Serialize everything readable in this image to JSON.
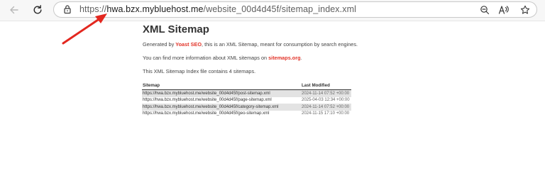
{
  "browser": {
    "url": {
      "scheme": "https://",
      "host": "hwa.bzx.mybluehost.me",
      "path": "/website_00d4d45f/sitemap_index.xml"
    },
    "icons": {
      "back": "arrow-left-icon",
      "refresh": "refresh-icon",
      "lock": "lock-icon",
      "zoom": "zoom-out-icon",
      "read_aloud": "read-aloud-icon",
      "favorite": "star-icon"
    }
  },
  "page": {
    "title": "XML Sitemap",
    "para1": {
      "prefix": "Generated by ",
      "link": "Yoast SEO",
      "suffix": ", this is an XML Sitemap, meant for consumption by search engines."
    },
    "para2": {
      "prefix": "You can find more information about XML sitemaps on ",
      "link": "sitemaps.org",
      "suffix": "."
    },
    "para3": "This XML Sitemap Index file contains 4 sitemaps.",
    "table": {
      "headers": [
        "Sitemap",
        "Last Modified"
      ],
      "rows": [
        {
          "url": "https://hwa.bzx.mybluehost.me/website_00d4d45f/post-sitemap.xml",
          "modified": "2024-11-14 07:52 +00:00"
        },
        {
          "url": "https://hwa.bzx.mybluehost.me/website_00d4d45f/page-sitemap.xml",
          "modified": "2025-04-03 12:34 +00:00"
        },
        {
          "url": "https://hwa.bzx.mybluehost.me/website_00d4d45f/category-sitemap.xml",
          "modified": "2024-11-14 07:52 +00:00"
        },
        {
          "url": "https://hwa.bzx.mybluehost.me/website_00d4d45f/geo-sitemap.xml",
          "modified": "2024-11-15 17:10 +00:00"
        }
      ]
    }
  },
  "annotation": {
    "color": "#e3271f"
  },
  "colors": {
    "link": "#e2352a",
    "toolbar": "#f7f7f7"
  }
}
